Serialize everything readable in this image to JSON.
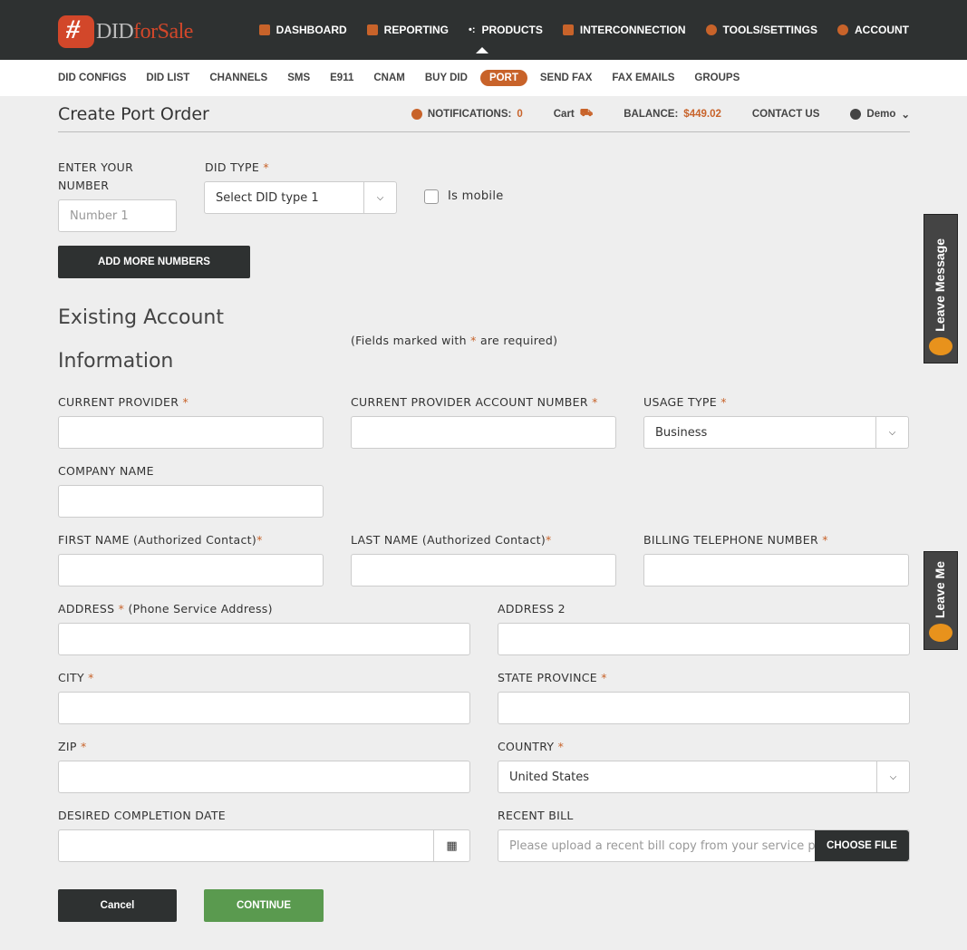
{
  "brand": {
    "logo_part1": "DID",
    "logo_part2": "forSale"
  },
  "main_nav": [
    {
      "label": "DASHBOARD",
      "icon": "dashboard-icon"
    },
    {
      "label": "REPORTING",
      "icon": "chart-icon"
    },
    {
      "label": "PRODUCTS",
      "icon": "dots-icon"
    },
    {
      "label": "INTERCONNECTION",
      "icon": "interconnection-icon"
    },
    {
      "label": "TOOLS/SETTINGS",
      "icon": "gear-icon"
    },
    {
      "label": "ACCOUNT",
      "icon": "user-icon"
    }
  ],
  "sub_nav": [
    {
      "label": "DID CONFIGS"
    },
    {
      "label": "DID LIST"
    },
    {
      "label": "CHANNELS"
    },
    {
      "label": "SMS"
    },
    {
      "label": "E911"
    },
    {
      "label": "CNAM"
    },
    {
      "label": "BUY DID"
    },
    {
      "label": "PORT",
      "active": true
    },
    {
      "label": "SEND FAX"
    },
    {
      "label": "FAX EMAILS"
    },
    {
      "label": "GROUPS"
    }
  ],
  "page": {
    "title": "Create Port Order"
  },
  "toolbar": {
    "notifications_label": "NOTIFICATIONS:",
    "notifications_count": "0",
    "cart": "Cart",
    "balance_label": "BALANCE:",
    "balance_value": "$449.02",
    "contact": "CONTACT US",
    "user": "Demo"
  },
  "numbers": {
    "enter_label": "ENTER YOUR NUMBER",
    "number_placeholder": "Number 1",
    "did_type_label": "DID TYPE",
    "did_type_value": "Select DID type 1",
    "is_mobile": "Is mobile",
    "add_more": "ADD MORE NUMBERS"
  },
  "account": {
    "heading_1": "Existing Account",
    "heading_2": "Information",
    "required_note_pre": "(Fields marked with",
    "required_note_post": "are required)"
  },
  "fields": {
    "current_provider": "CURRENT PROVIDER",
    "account_number": "CURRENT PROVIDER ACCOUNT NUMBER",
    "usage_type": "USAGE TYPE",
    "usage_type_value": "Business",
    "company_name": "COMPANY NAME",
    "first_name": "FIRST NAME (Authorized Contact)",
    "last_name": "LAST NAME (Authorized Contact)",
    "billing_tn": "BILLING TELEPHONE NUMBER",
    "address": "ADDRESS",
    "address_note": "(Phone Service Address)",
    "address2": "ADDRESS 2",
    "city": "CITY",
    "state": "STATE PROVINCE",
    "zip": "ZIP",
    "country": "COUNTRY",
    "country_value": "United States",
    "completion_date": "DESIRED COMPLETION DATE",
    "recent_bill": "RECENT BILL",
    "recent_bill_placeholder": "Please upload a recent bill copy from your service provider",
    "choose_file": "CHOOSE FILE"
  },
  "actions": {
    "cancel": "Cancel",
    "continue": "CONTINUE"
  },
  "widget": {
    "leave_message": "Leave Message",
    "leave_message_partial": "Leave Me"
  },
  "colors": {
    "accent": "#c8632a",
    "header": "#2e3131",
    "continue": "#5a9a4f"
  }
}
